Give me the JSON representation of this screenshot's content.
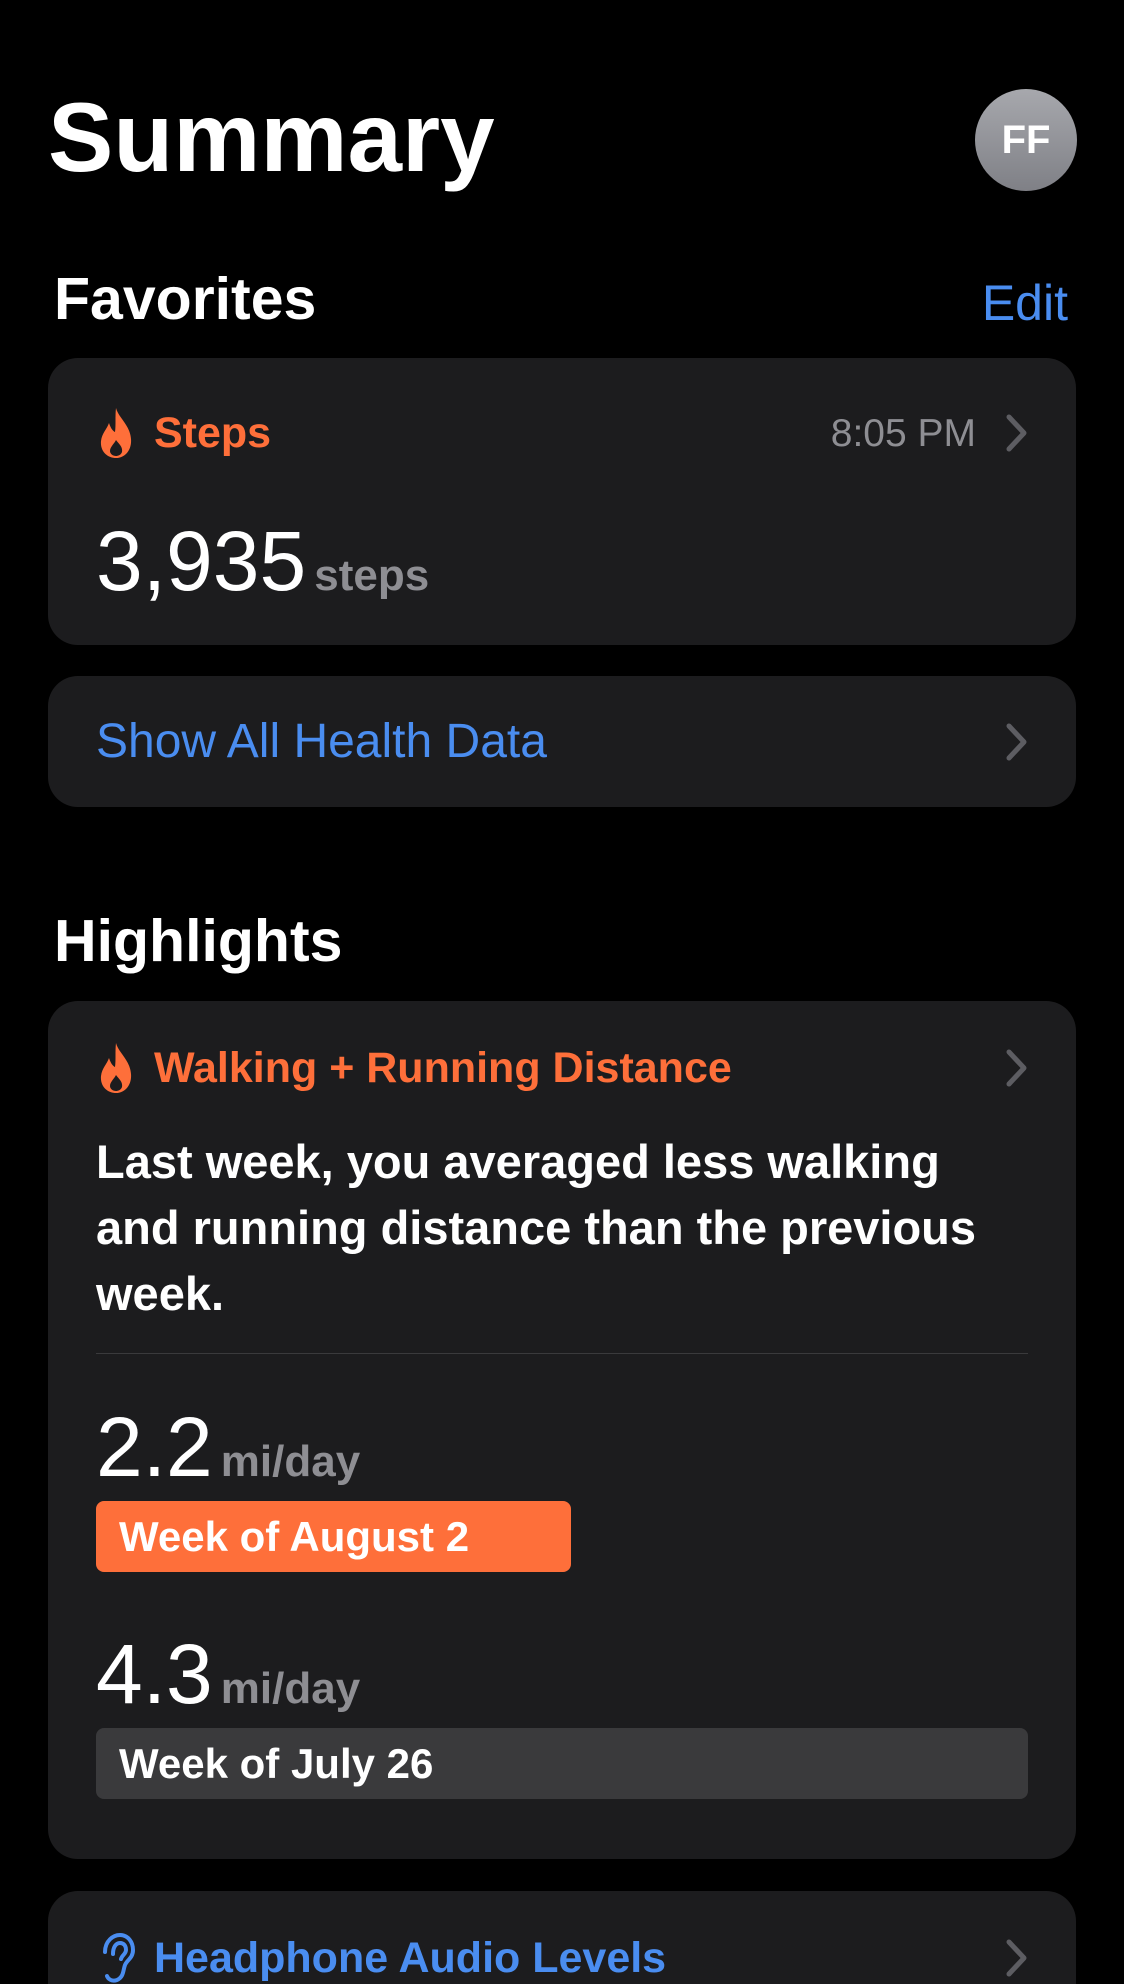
{
  "header": {
    "title": "Summary",
    "avatar_initials": "FF"
  },
  "favorites": {
    "section_title": "Favorites",
    "edit_label": "Edit",
    "steps_card": {
      "label": "Steps",
      "icon": "flame-icon",
      "time": "8:05 PM",
      "value": "3,935",
      "unit": "steps"
    },
    "show_all_label": "Show All Health Data"
  },
  "highlights": {
    "section_title": "Highlights",
    "distance_card": {
      "label": "Walking + Running Distance",
      "icon": "flame-icon",
      "summary": "Last week, you averaged less walking and running distance than the previous week.",
      "current": {
        "value": "2.2",
        "unit": "mi/day",
        "week_label": "Week of August 2",
        "fraction_of_max": 0.51
      },
      "previous": {
        "value": "4.3",
        "unit": "mi/day",
        "week_label": "Week of July 26",
        "fraction_of_max": 1.0
      }
    },
    "audio_card": {
      "label": "Headphone Audio Levels",
      "icon": "ear-icon"
    }
  },
  "colors": {
    "accent_orange": "#fe6f3a",
    "accent_blue": "#4a8df0",
    "card_bg": "#1c1c1e",
    "secondary_text": "#8e8e93",
    "inactive_bar": "#3a3a3c"
  }
}
